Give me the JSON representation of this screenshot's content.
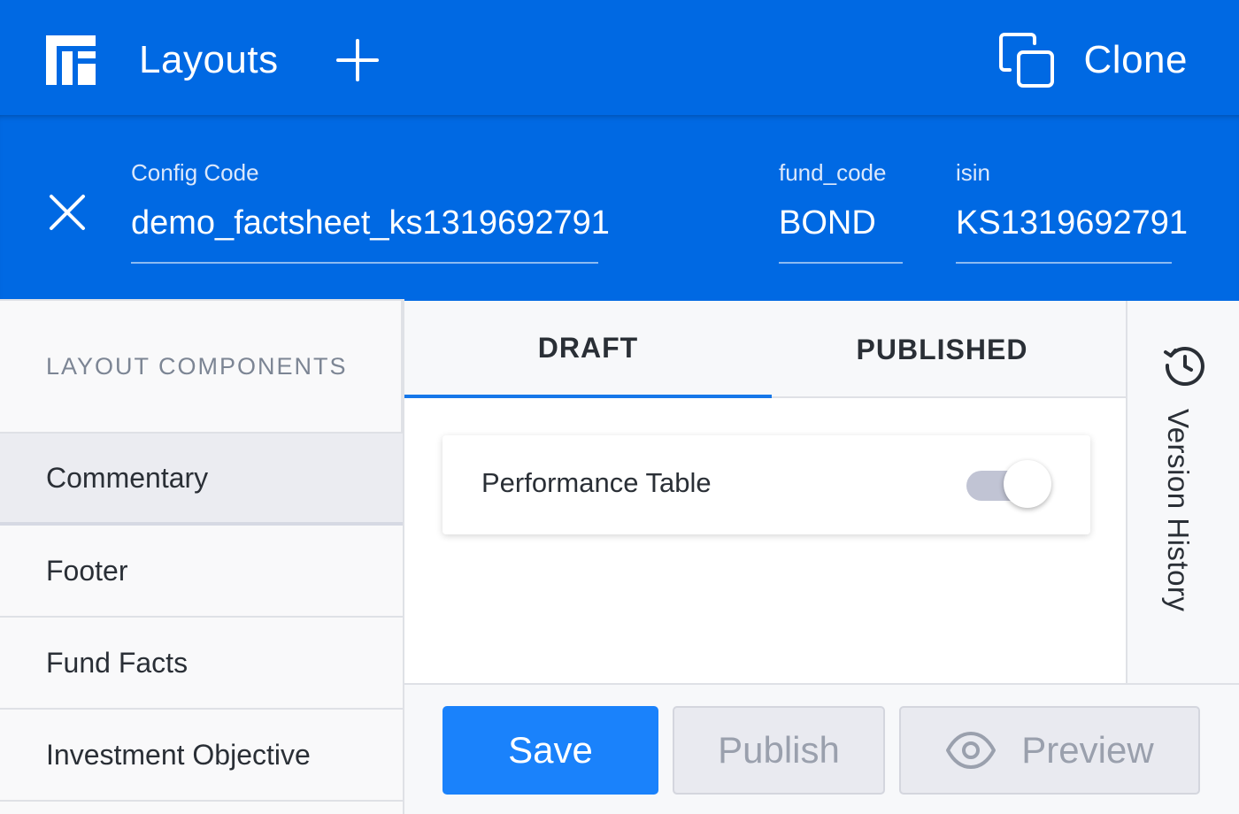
{
  "header": {
    "logo_icon": "layout-grid-icon",
    "title": "Layouts",
    "add_icon": "plus-icon",
    "clone_icon": "copy-icon",
    "clone_label": "Clone",
    "background": "#0069e3"
  },
  "config": {
    "close_icon": "close-icon",
    "fields": [
      {
        "label": "Config Code",
        "value": "demo_factsheet_ks1319692791"
      },
      {
        "label": "fund_code",
        "value": "BOND"
      },
      {
        "label": "isin",
        "value": "KS1319692791"
      }
    ]
  },
  "sidebar": {
    "heading": "LAYOUT COMPONENTS",
    "items": [
      {
        "label": "Commentary",
        "active": true
      },
      {
        "label": "Footer",
        "active": false
      },
      {
        "label": "Fund Facts",
        "active": false
      },
      {
        "label": "Investment Objective",
        "active": false
      }
    ]
  },
  "main": {
    "tabs": [
      {
        "label": "DRAFT",
        "active": true
      },
      {
        "label": "PUBLISHED",
        "active": false
      }
    ],
    "components": [
      {
        "label": "Performance Table",
        "toggle_on": false
      }
    ]
  },
  "version_history": {
    "icon": "history-icon",
    "label": "Version History"
  },
  "footer": {
    "save_label": "Save",
    "publish_label": "Publish",
    "preview_label": "Preview",
    "preview_icon": "eye-icon",
    "accent": "#1a82fb"
  }
}
